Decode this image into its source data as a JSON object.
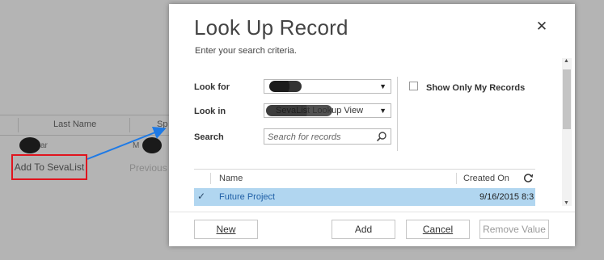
{
  "background": {
    "last_name_header": "Last Name",
    "sp_header": "Sp",
    "cell_1": "ar",
    "cell_2": "M",
    "add_to_list_label": "Add To SevaList",
    "previous_label": "Previous"
  },
  "dialog": {
    "title": "Look Up Record",
    "subtitle": "Enter your search criteria.",
    "close_label": "✕",
    "look_for_label": "Look for",
    "look_for_value": "",
    "look_in_label": "Look in",
    "look_in_value": "SevaList Lookup View",
    "search_label": "Search",
    "search_placeholder": "Search for records",
    "show_only_my_records_label": "Show Only My Records",
    "show_only_my_records_checked": false
  },
  "grid": {
    "columns": [
      "Name",
      "Created On"
    ],
    "rows": [
      {
        "selected": true,
        "name": "Future Project",
        "created_on": "9/16/2015 8:3"
      }
    ]
  },
  "footer": {
    "new_label": "New",
    "add_label": "Add",
    "cancel_label": "Cancel",
    "remove_value_label": "Remove Value"
  },
  "colors": {
    "highlight_row": "#b1d6f0",
    "callout_border": "#e0141e",
    "arrow": "#1e7ae6",
    "link_text": "#1f5fa6"
  }
}
